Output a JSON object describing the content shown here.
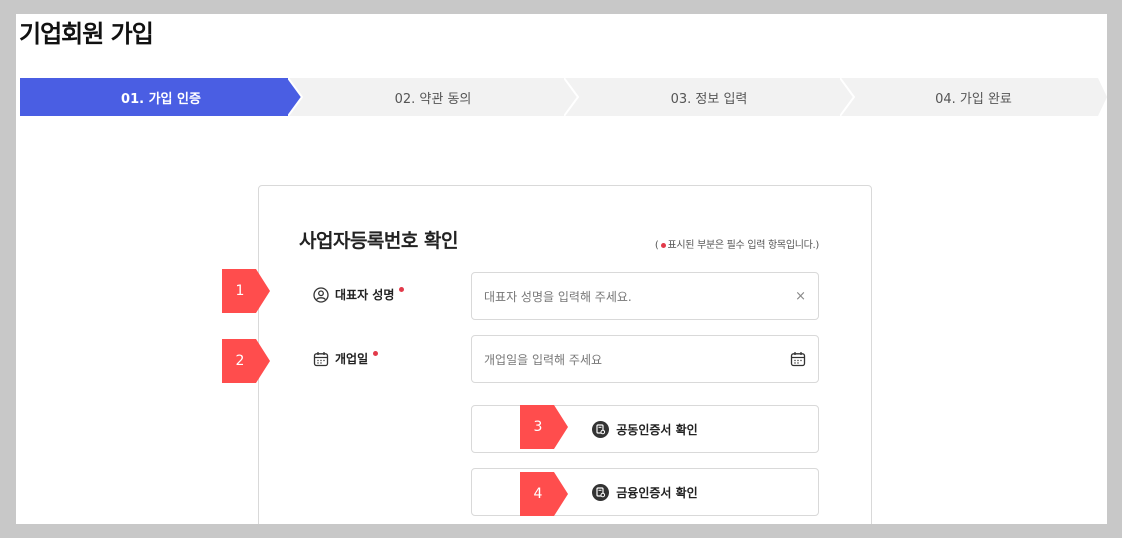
{
  "page": {
    "title": "기업회원 가입"
  },
  "steps": [
    {
      "label": "01. 가입 인증",
      "active": true
    },
    {
      "label": "02. 약관 동의",
      "active": false
    },
    {
      "label": "03. 정보 입력",
      "active": false
    },
    {
      "label": "04. 가입 완료",
      "active": false
    }
  ],
  "colors": {
    "accent": "#4a5ee3",
    "required": "#e23a4a",
    "marker": "#ff4d4d",
    "step_inactive": "#f2f2f2"
  },
  "form": {
    "title": "사업자등록번호 확인",
    "required_note_prefix": "(",
    "required_note_text": "표시된 부분은 필수 입력 항목입니다.)",
    "representative": {
      "label": "대표자 성명",
      "placeholder": "대표자 성명을 입력해 주세요.",
      "clear_icon": "×",
      "icon": "user-circle-icon"
    },
    "open_date": {
      "label": "개업일",
      "placeholder": "개업일을 입력해 주세요",
      "icon": "calendar-icon"
    },
    "joint_cert_label": "공동인증서 확인",
    "finance_cert_label": "금융인증서 확인"
  },
  "markers": [
    "1",
    "2",
    "3",
    "4"
  ]
}
